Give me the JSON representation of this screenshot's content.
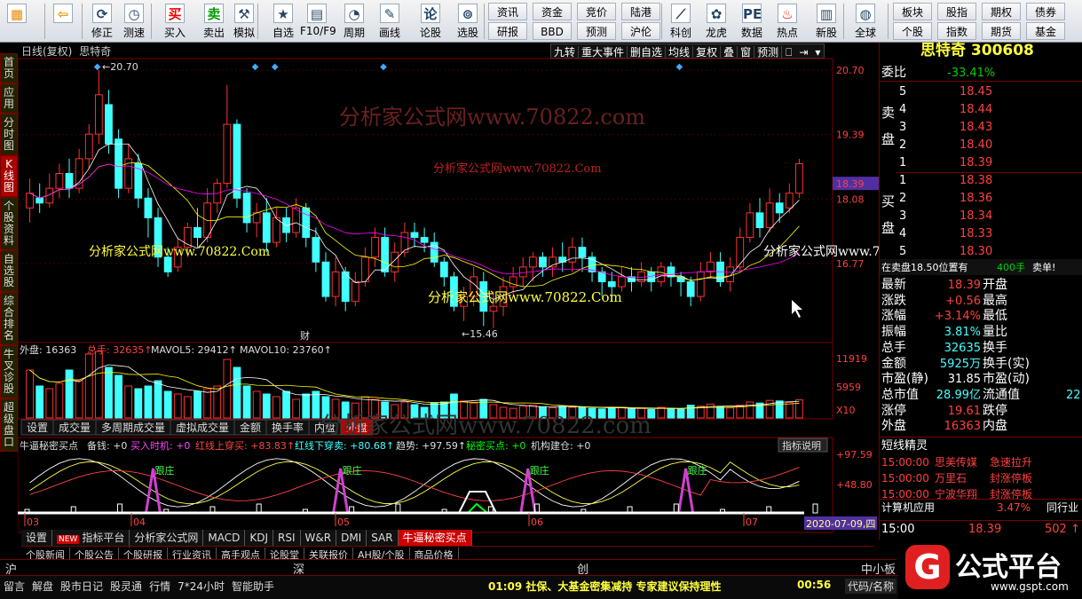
{
  "toolbar": {
    "buttons": [
      {
        "name": "windows-icon",
        "label": ""
      },
      {
        "name": "back-icon",
        "label": ""
      },
      {
        "name": "fix-icon",
        "label": "修正"
      },
      {
        "name": "measure-icon",
        "label": "测速"
      },
      {
        "name": "buy-icon",
        "label": "买入",
        "glyph": "买"
      },
      {
        "name": "sell-icon",
        "label": "卖出",
        "glyph": "卖"
      },
      {
        "name": "hammer-icon",
        "label": "模拟"
      },
      {
        "name": "star-icon",
        "label": "自选"
      },
      {
        "name": "f10-icon",
        "label": "F10/F9"
      },
      {
        "name": "period-icon",
        "label": "周期"
      },
      {
        "name": "draw-icon",
        "label": "画线"
      },
      {
        "name": "stockview-icon",
        "label": "论股",
        "glyph": "论"
      },
      {
        "name": "select-icon",
        "label": "选股"
      }
    ],
    "grid": [
      [
        "资讯",
        "资金",
        "竞价",
        "陆港"
      ],
      [
        "研报",
        "BBD",
        "预测",
        "沪伦"
      ]
    ],
    "buttons2": [
      {
        "name": "kline-icon",
        "label": "科创"
      },
      {
        "name": "dragon-icon",
        "label": "龙虎"
      },
      {
        "name": "pe-icon",
        "label": "数据",
        "glyph": "PE"
      },
      {
        "name": "hot-icon",
        "label": "热点"
      },
      {
        "name": "new-icon",
        "label": "新股"
      },
      {
        "name": "globe-icon",
        "label": "全球"
      }
    ],
    "grid2": [
      [
        "板块",
        "股指",
        "期权",
        "债券"
      ],
      [
        "个股",
        "指数",
        "期货",
        "基金"
      ]
    ]
  },
  "lefttabs": [
    "首页",
    "应用",
    "分时图",
    "K线图",
    "个股资料",
    "自选股",
    "综合排名",
    "牛叉诊股",
    "超级盘口"
  ],
  "chart_header": {
    "mode": "日线(复权)",
    "name": "思特奇",
    "buttons": [
      "九转",
      "重大事件",
      "删自选",
      "均线",
      "复权",
      "叠",
      "窗",
      "预测"
    ]
  },
  "price_axis": [
    "20.70",
    "19.39",
    "18.08",
    "18.39",
    "16.77"
  ],
  "vol_axis": [
    "11919",
    "5959",
    "X10"
  ],
  "ind_axis": [
    "+97.59",
    "+48.80"
  ],
  "annotations": {
    "high": "20.70",
    "low": "15.46",
    "cai": "财"
  },
  "vol_header": {
    "a": "外盘: 16363",
    "b": "总手: 32635↑",
    "c": "MAVOL5: 29412↑",
    "d": "MAVOL10: 23760↑"
  },
  "vol_tabs": [
    "设置",
    "成交量",
    "多周期成交量",
    "虚拟成交量",
    "金额",
    "换手率",
    "内盘",
    "外盘"
  ],
  "ind_header": {
    "name": "牛逼秘密买点",
    "spare": "备钱: +0",
    "buy": "买入时机: +0",
    "red_up": "红线上穿买: +83.83↑",
    "red_down": "红线下穿卖: +80.68↑",
    "trend": "趋势: +97.59↑",
    "secret": "秘密买点: +0",
    "inst": "机构建仓: +0",
    "explain": "指标说明"
  },
  "ind_labels": [
    "跟庄",
    "跟庄",
    "跟庄",
    "跟庄"
  ],
  "months": [
    "03",
    "04",
    "05",
    "06",
    "07"
  ],
  "date_box": "2020-07-09,四",
  "ind_tabs": [
    "设置",
    "指标平台",
    "分析家公式网",
    "MACD",
    "KDJ",
    "RSI",
    "W&R",
    "DMI",
    "SAR",
    "牛逼秘密买点"
  ],
  "new_badge": "NEW",
  "bottom_tabs": [
    "个股新闻",
    "个股公告",
    "个股研报",
    "行业资讯",
    "高手观点",
    "论股堂",
    "关联报价",
    "AH股/个股",
    "商品价格"
  ],
  "market": {
    "sh": "沪",
    "sz": "深",
    "cy": "创",
    "zz": "中小板"
  },
  "status": [
    "留言",
    "解盘",
    "股市日记",
    "股灵通",
    "行情",
    "7*24小时",
    "智能助手"
  ],
  "ticker": "01:09 社保、大基金密集减持 专家建议保持理性",
  "time": "00:56",
  "code_label": "代码/名称",
  "right": {
    "title": "思特奇 300608",
    "weibi": "委比",
    "weibi_v": "-33.41%",
    "sell": [
      [
        "5",
        "18.45"
      ],
      [
        "4",
        "18.44"
      ],
      [
        "3",
        "18.43"
      ],
      [
        "2",
        "18.40"
      ],
      [
        "1",
        "18.39"
      ]
    ],
    "buy": [
      [
        "1",
        "18.38"
      ],
      [
        "2",
        "18.36"
      ],
      [
        "3",
        "18.34"
      ],
      [
        "4",
        "18.33"
      ],
      [
        "5",
        "18.30"
      ]
    ],
    "sell_lbl": [
      "卖",
      "盘"
    ],
    "buy_lbl": [
      "买",
      "盘"
    ],
    "notice": "在卖盘18.50位置有",
    "notice_v": "400手",
    "notice_t": "卖单!",
    "stats": [
      [
        "最新",
        "18.39",
        "开盘"
      ],
      [
        "涨跌",
        "+0.56",
        "最高"
      ],
      [
        "涨幅",
        "+3.14%",
        "最低"
      ],
      [
        "振幅",
        "3.81%",
        "量比"
      ],
      [
        "总手",
        "32635",
        "换手"
      ],
      [
        "金额",
        "5925万",
        "换手(实)"
      ],
      [
        "市盈(静)",
        "31.85",
        "市盈(动)"
      ],
      [
        "总市值",
        "28.99亿",
        "流通值"
      ],
      [
        "涨停",
        "19.61",
        "跌停"
      ],
      [
        "外盘",
        "16363",
        "内盘"
      ]
    ],
    "extra22": "22",
    "fast": "短线精灵",
    "fast_rows": [
      [
        "15:00:00",
        "思美传媒",
        "急速拉升"
      ],
      [
        "15:00:00",
        "万里石",
        "封涨停板"
      ],
      [
        "15:00:00",
        "宁波华翔",
        "封涨停板"
      ]
    ],
    "sector": "计算机应用",
    "sector_v": "3.47%",
    "sector_t": "同行业",
    "last_time": "15:00",
    "last_price": "18.39",
    "last_vol": "502"
  },
  "watermarks": [
    "分析家公式网www.70822.com",
    "分析家公式网www.70822.Com",
    "分析家公式网www.70822.Com",
    "分析家公式网www.70822.Com",
    "分析家公式网www.70822.Com",
    "分析家公式网www.70822.com"
  ],
  "logo": {
    "text": "公式平台",
    "url": "www.gspt.com"
  }
}
